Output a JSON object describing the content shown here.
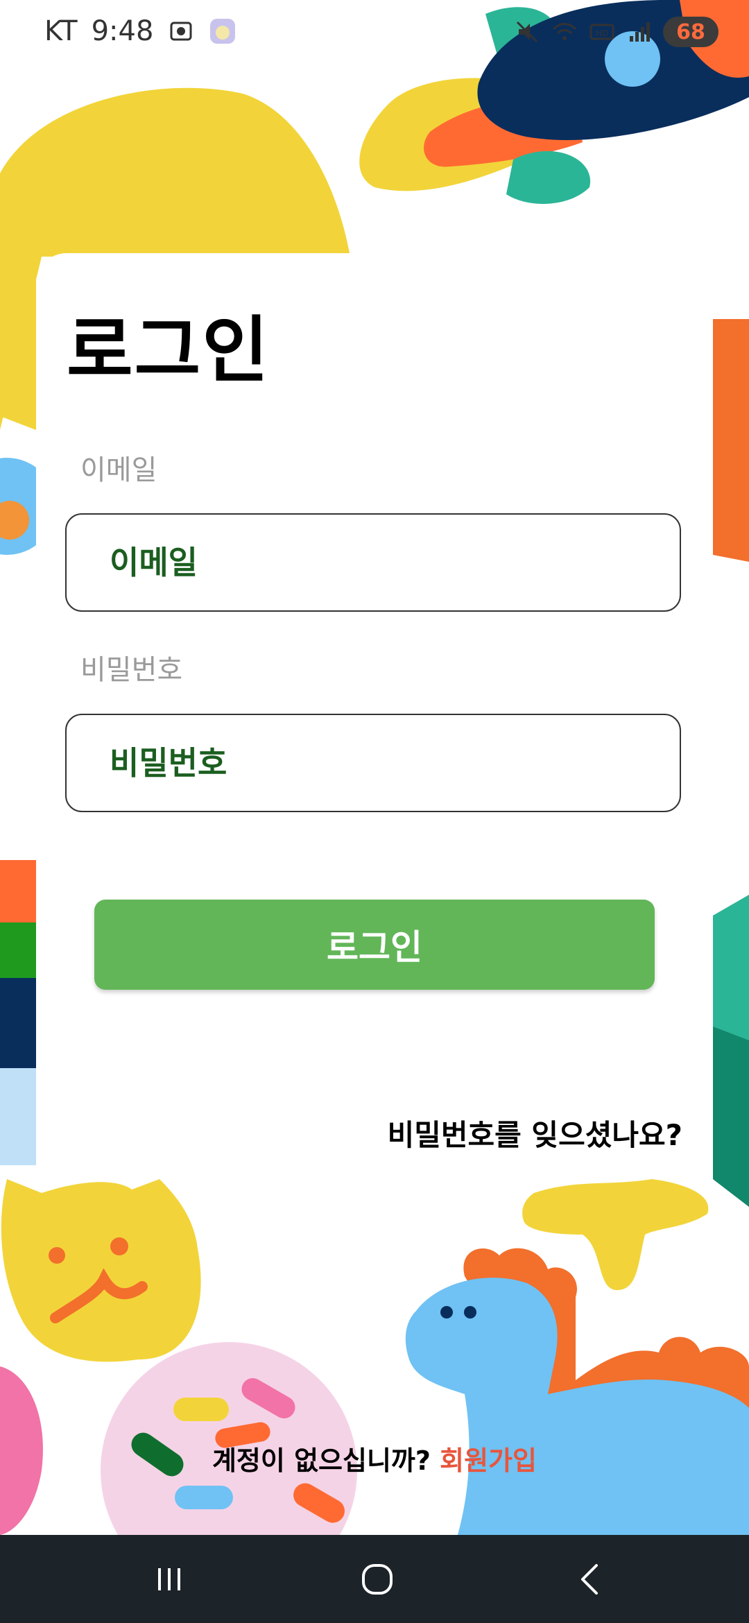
{
  "status_bar": {
    "carrier": "KT",
    "time": "9:48",
    "battery": "68",
    "icons": [
      "screenshot-icon",
      "app-notification-icon",
      "mute-icon",
      "wifi-icon",
      "hd-icon",
      "signal-icon",
      "battery-icon"
    ]
  },
  "login": {
    "title": "로그인",
    "email_label": "이메일",
    "email_placeholder": "이메일",
    "password_label": "비밀번호",
    "password_placeholder": "비밀번호",
    "login_button": "로그인",
    "forgot_password": "비밀번호를 잊으셨나요?"
  },
  "signup": {
    "prompt": "계정이 없으십니까?",
    "link": "회원가입"
  },
  "nav": {
    "icons": [
      "recents-icon",
      "home-icon",
      "back-icon"
    ]
  },
  "colors": {
    "button": "#62b658",
    "input_text": "#1b5e20",
    "signup_link": "#e8553c",
    "nav_background": "#1c2329"
  }
}
